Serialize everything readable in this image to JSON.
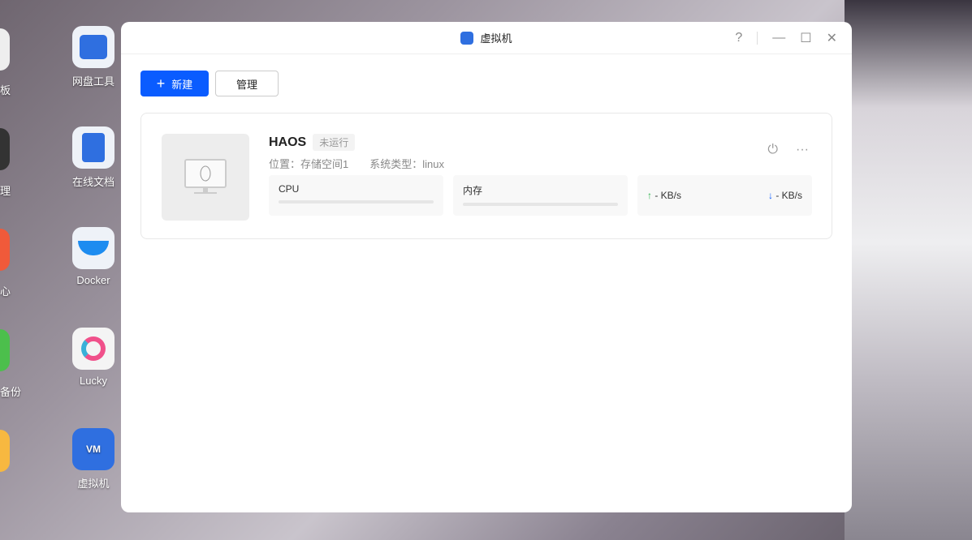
{
  "desktop": {
    "left_partial": [
      "板",
      "理",
      "心",
      "备份"
    ],
    "icons": [
      {
        "label": "网盘工具"
      },
      {
        "label": "在线文档"
      },
      {
        "label": "Docker"
      },
      {
        "label": "Lucky"
      },
      {
        "label": "虚拟机",
        "glyph": "VM"
      }
    ]
  },
  "window": {
    "title": "虚拟机",
    "help": "?"
  },
  "toolbar": {
    "new_label": "新建",
    "manage_label": "管理"
  },
  "vm": {
    "name": "HAOS",
    "status": "未运行",
    "location": "位置：存储空间1",
    "os_type": "系统类型：linux",
    "cpu_label": "CPU",
    "cpu_percent": 0,
    "mem_label": "内存",
    "mem_percent": 0,
    "upload": "- KB/s",
    "download": "- KB/s"
  }
}
